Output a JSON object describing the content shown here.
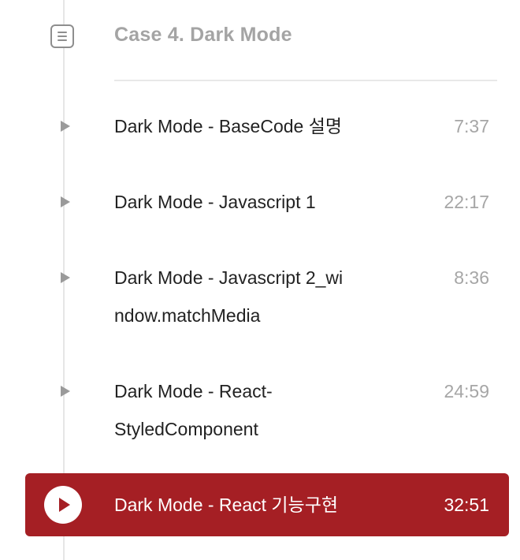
{
  "section": {
    "icon": "document-list-icon",
    "title": "Case 4. Dark Mode"
  },
  "lessons": [
    {
      "title": "Dark Mode - BaseCode 설명",
      "duration": "7:37",
      "icon": "play-triangle-icon",
      "active": false
    },
    {
      "title": "Dark Mode - Javascript 1",
      "duration": "22:17",
      "icon": "play-triangle-icon",
      "active": false
    },
    {
      "title": "Dark Mode - Javascript 2_window.matchMedia",
      "duration": "8:36",
      "icon": "play-triangle-icon",
      "active": false
    },
    {
      "title": "Dark Mode - React-StyledComponent",
      "duration": "24:59",
      "icon": "play-triangle-icon",
      "active": false
    },
    {
      "title": "Dark Mode - React 기능구현",
      "duration": "32:51",
      "icon": "play-circle-icon",
      "active": true
    }
  ],
  "colors": {
    "active_background": "#a51f24",
    "section_title": "#a4a4a4",
    "duration": "#a6a6a6",
    "timeline": "#e6e6e6"
  }
}
